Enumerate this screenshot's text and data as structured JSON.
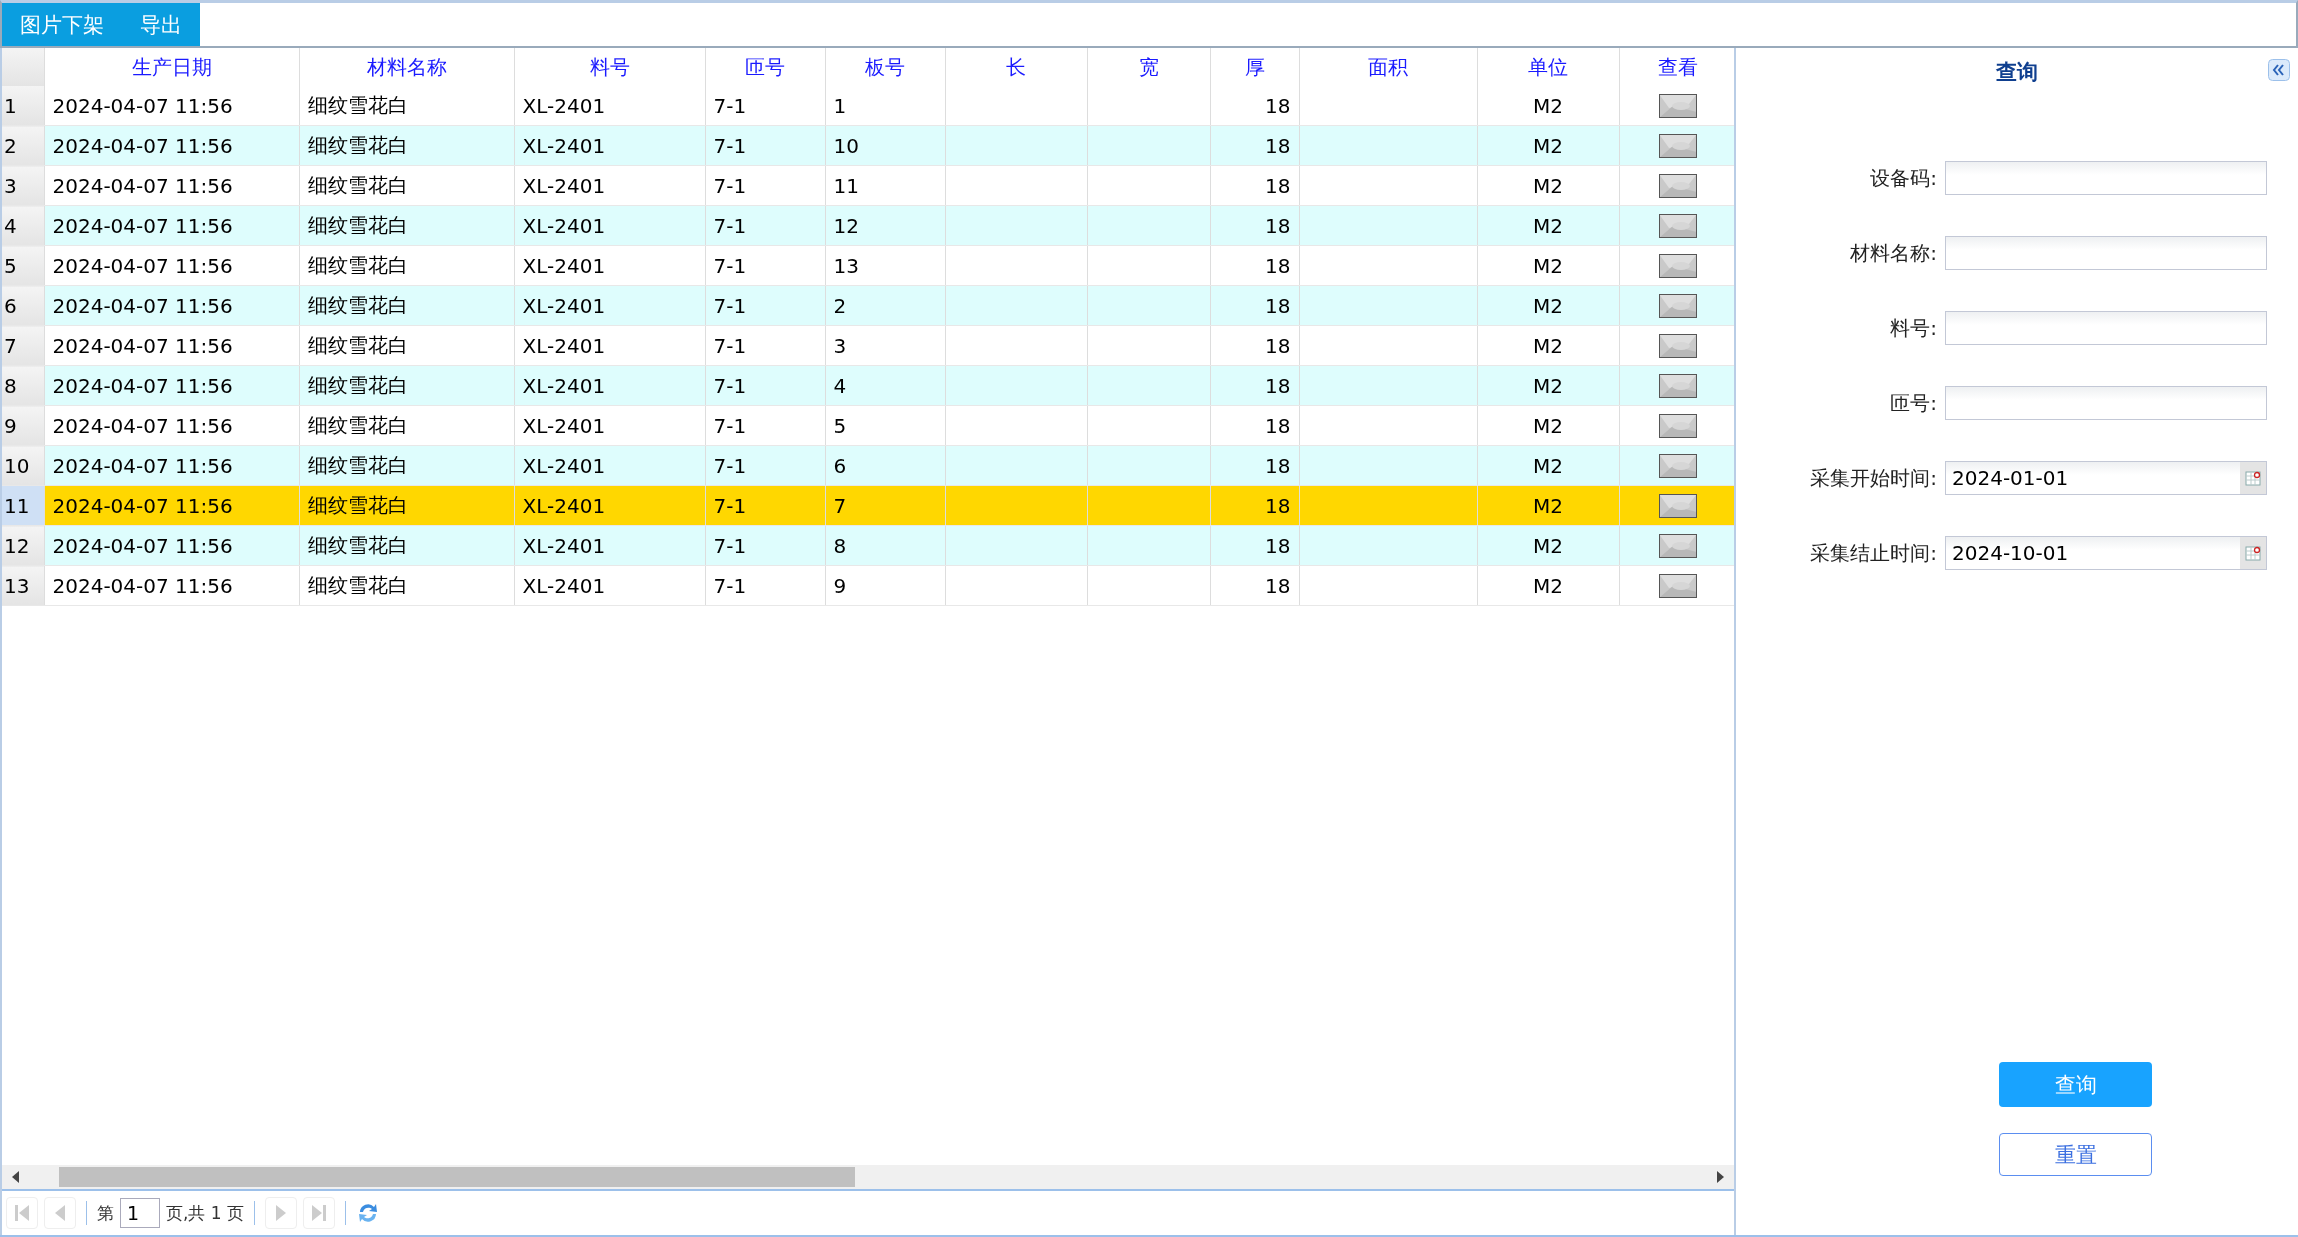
{
  "toolbar": {
    "buttons": [
      "图片下架",
      "导出"
    ]
  },
  "table": {
    "columns": [
      "生产日期",
      "材料名称",
      "料号",
      "匝号",
      "板号",
      "长",
      "宽",
      "厚",
      "面积",
      "单位",
      "查看"
    ],
    "rows": [
      {
        "num": "1",
        "date": "2024-04-07 11:56",
        "name": "细纹雪花白",
        "code": "XL-2401",
        "batch": "7-1",
        "board": "1",
        "thickness": "18",
        "unit": "M2",
        "selected": false
      },
      {
        "num": "2",
        "date": "2024-04-07 11:56",
        "name": "细纹雪花白",
        "code": "XL-2401",
        "batch": "7-1",
        "board": "10",
        "thickness": "18",
        "unit": "M2",
        "selected": false
      },
      {
        "num": "3",
        "date": "2024-04-07 11:56",
        "name": "细纹雪花白",
        "code": "XL-2401",
        "batch": "7-1",
        "board": "11",
        "thickness": "18",
        "unit": "M2",
        "selected": false
      },
      {
        "num": "4",
        "date": "2024-04-07 11:56",
        "name": "细纹雪花白",
        "code": "XL-2401",
        "batch": "7-1",
        "board": "12",
        "thickness": "18",
        "unit": "M2",
        "selected": false
      },
      {
        "num": "5",
        "date": "2024-04-07 11:56",
        "name": "细纹雪花白",
        "code": "XL-2401",
        "batch": "7-1",
        "board": "13",
        "thickness": "18",
        "unit": "M2",
        "selected": false
      },
      {
        "num": "6",
        "date": "2024-04-07 11:56",
        "name": "细纹雪花白",
        "code": "XL-2401",
        "batch": "7-1",
        "board": "2",
        "thickness": "18",
        "unit": "M2",
        "selected": false
      },
      {
        "num": "7",
        "date": "2024-04-07 11:56",
        "name": "细纹雪花白",
        "code": "XL-2401",
        "batch": "7-1",
        "board": "3",
        "thickness": "18",
        "unit": "M2",
        "selected": false
      },
      {
        "num": "8",
        "date": "2024-04-07 11:56",
        "name": "细纹雪花白",
        "code": "XL-2401",
        "batch": "7-1",
        "board": "4",
        "thickness": "18",
        "unit": "M2",
        "selected": false
      },
      {
        "num": "9",
        "date": "2024-04-07 11:56",
        "name": "细纹雪花白",
        "code": "XL-2401",
        "batch": "7-1",
        "board": "5",
        "thickness": "18",
        "unit": "M2",
        "selected": false
      },
      {
        "num": "10",
        "date": "2024-04-07 11:56",
        "name": "细纹雪花白",
        "code": "XL-2401",
        "batch": "7-1",
        "board": "6",
        "thickness": "18",
        "unit": "M2",
        "selected": false
      },
      {
        "num": "11",
        "date": "2024-04-07 11:56",
        "name": "细纹雪花白",
        "code": "XL-2401",
        "batch": "7-1",
        "board": "7",
        "thickness": "18",
        "unit": "M2",
        "selected": true
      },
      {
        "num": "12",
        "date": "2024-04-07 11:56",
        "name": "细纹雪花白",
        "code": "XL-2401",
        "batch": "7-1",
        "board": "8",
        "thickness": "18",
        "unit": "M2",
        "selected": false
      },
      {
        "num": "13",
        "date": "2024-04-07 11:56",
        "name": "细纹雪花白",
        "code": "XL-2401",
        "batch": "7-1",
        "board": "9",
        "thickness": "18",
        "unit": "M2",
        "selected": false
      }
    ]
  },
  "pagination": {
    "prefix": "第",
    "page": "1",
    "suffix": "页,共 1 页"
  },
  "search_panel": {
    "title": "查询",
    "fields": [
      {
        "label": "设备码:",
        "kind": "text"
      },
      {
        "label": "材料名称:",
        "kind": "text"
      },
      {
        "label": "料号:",
        "kind": "text"
      },
      {
        "label": "匝号:",
        "kind": "text"
      },
      {
        "label": "采集开始时间:",
        "kind": "date",
        "value": "2024-01-01"
      },
      {
        "label": "采集结止时间:",
        "kind": "date",
        "value": "2024-10-01"
      }
    ],
    "buttons": [
      {
        "label": "查询",
        "kind": "primary"
      },
      {
        "label": "重置",
        "kind": "outline"
      }
    ]
  }
}
